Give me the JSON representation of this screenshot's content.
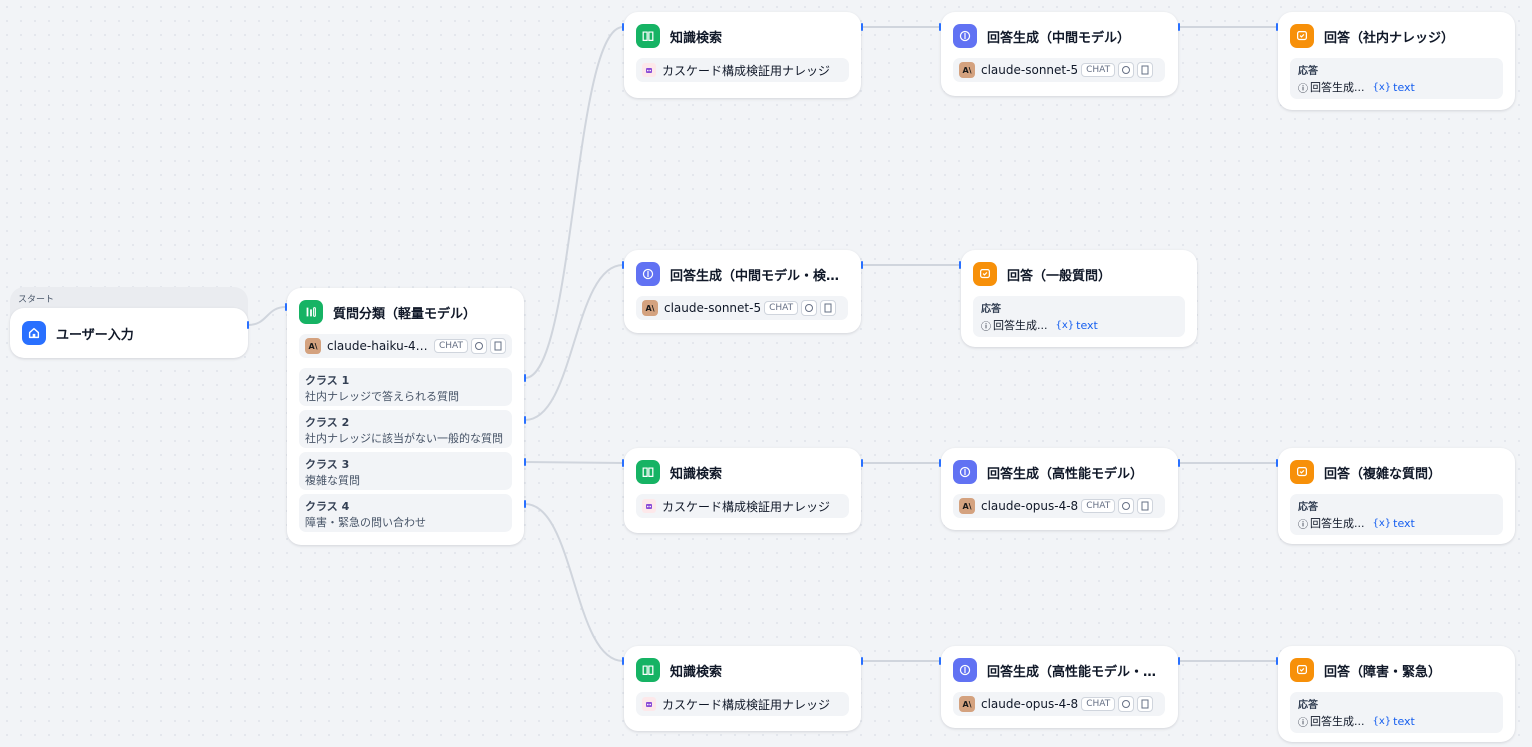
{
  "start": {
    "label": "スタート",
    "title": "ユーザー入力"
  },
  "classifier": {
    "title": "質問分類（軽量モデル）",
    "model": "claude-haiku-4-...",
    "mode": "CHAT",
    "classes": [
      {
        "name": "クラス 1",
        "desc": "社内ナレッジで答えられる質問"
      },
      {
        "name": "クラス 2",
        "desc": "社内ナレッジに該当がない一般的な質問"
      },
      {
        "name": "クラス 3",
        "desc": "複雑な質問"
      },
      {
        "name": "クラス 4",
        "desc": "障害・緊急の問い合わせ"
      }
    ]
  },
  "knowledge": {
    "title": "知識検索",
    "kb_name": "カスケード構成検証用ナレッジ"
  },
  "llm": {
    "mid": {
      "title": "回答生成（中間モデル）",
      "model": "claude-sonnet-5"
    },
    "mid_nosearch": {
      "title": "回答生成（中間モデル・検索な...",
      "model": "claude-sonnet-5"
    },
    "high": {
      "title": "回答生成（高性能モデル）",
      "model": "claude-opus-4-8"
    },
    "high_sure": {
      "title": "回答生成（高性能モデル・確実...",
      "model": "claude-opus-4-8"
    },
    "mode": "CHAT"
  },
  "answer": {
    "internal": {
      "title": "回答（社内ナレッジ）"
    },
    "general": {
      "title": "回答（一般質問）"
    },
    "complex": {
      "title": "回答（複雑な質問）"
    },
    "incident": {
      "title": "回答（障害・緊急）"
    },
    "label": "応答",
    "ref": "回答生成...",
    "var": "text"
  },
  "colors": {
    "knowledge_icon": "#16b364",
    "start_icon": "#2970ff",
    "llm_icon": "#6172f3",
    "answer_icon": "#f79009",
    "edge": "#d0d5dd",
    "handle": "#2970ff"
  }
}
